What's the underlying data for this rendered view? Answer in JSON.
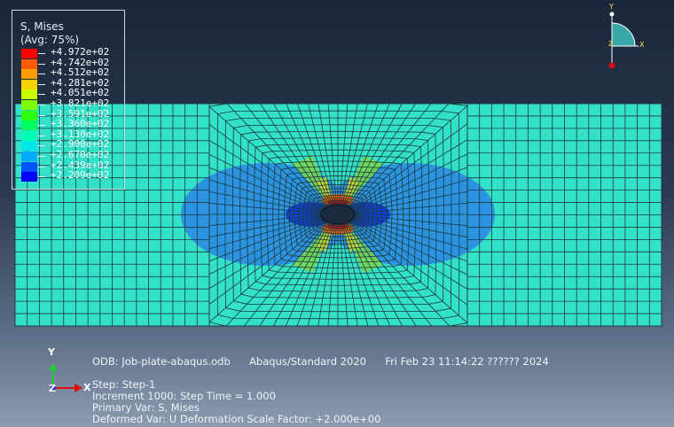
{
  "legend": {
    "title": "S, Mises",
    "subtitle": "(Avg: 75%)",
    "items": [
      {
        "label": "+4.972e+02",
        "color": "#ff0000"
      },
      {
        "label": "+4.742e+02",
        "color": "#ff5a00"
      },
      {
        "label": "+4.512e+02",
        "color": "#ff9c00"
      },
      {
        "label": "+4.281e+02",
        "color": "#f5d200"
      },
      {
        "label": "+4.051e+02",
        "color": "#c8ff00"
      },
      {
        "label": "+3.821e+02",
        "color": "#7cff00"
      },
      {
        "label": "+3.591e+02",
        "color": "#2cff10"
      },
      {
        "label": "+3.360e+02",
        "color": "#00ff5a"
      },
      {
        "label": "+3.130e+02",
        "color": "#00ffb4"
      },
      {
        "label": "+2.900e+02",
        "color": "#00e6e6"
      },
      {
        "label": "+2.670e+02",
        "color": "#00aaff"
      },
      {
        "label": "+2.439e+02",
        "color": "#0055ff"
      },
      {
        "label": "+2.209e+02",
        "color": "#0000ff"
      }
    ]
  },
  "info": {
    "odb": "ODB: Job-plate-abaqus.odb",
    "solver": "Abaqus/Standard 2020",
    "date": "Fri Feb 23 11:14:22 ?????? 2024",
    "step": "Step: Step-1",
    "increment": "Increment   1000: Step Time =     1.000",
    "primary_var": "Primary Var: S, Mises",
    "deformed_var": "Deformed Var: U   Deformation Scale Factor: +2.000e+00"
  },
  "triad": {
    "x": "X",
    "y": "Y",
    "z": "Z"
  },
  "view_cube": {
    "x": "X",
    "y": "Y",
    "z": "Z"
  },
  "colors": {
    "mesh_base": "#33e0c8",
    "mesh_line": "#1b3a3a",
    "lobe_blue": "#2a8fe0",
    "hole": "#1a2a3a",
    "background_top": "#1a2639",
    "background_bottom": "#8c9bb0"
  }
}
